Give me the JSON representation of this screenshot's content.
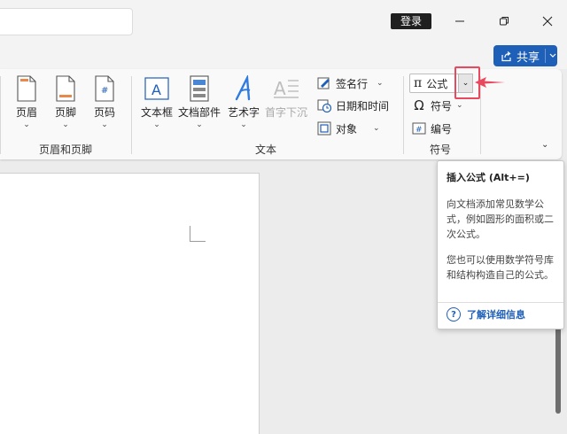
{
  "titlebar": {
    "login_label": "登录",
    "minimize_icon": "minimize-icon",
    "maximize_icon": "restore-icon",
    "close_icon": "close-icon"
  },
  "share": {
    "label": "共享"
  },
  "ribbon": {
    "header_footer_group": {
      "label": "页眉和页脚",
      "header": "页眉",
      "footer": "页脚",
      "page_number": "页码"
    },
    "text_group": {
      "label": "文本",
      "textbox": "文本框",
      "quick_parts": "文档部件",
      "wordart": "艺术字",
      "drop_cap": "首字下沉",
      "signature_line": "签名行",
      "date_time": "日期和时间",
      "object": "对象"
    },
    "symbols_group": {
      "label": "符号",
      "equation": "公式",
      "symbol": "符号",
      "numbering": "编号"
    }
  },
  "tooltip": {
    "title": "插入公式 (Alt+=)",
    "body1": "向文档添加常见数学公式，例如圆形的面积或二次公式。",
    "body2": "您也可以使用数学符号库和结构构造自己的公式。",
    "link": "了解详细信息"
  },
  "colors": {
    "accent": "#1e5fb8",
    "highlight": "#e8495f"
  }
}
